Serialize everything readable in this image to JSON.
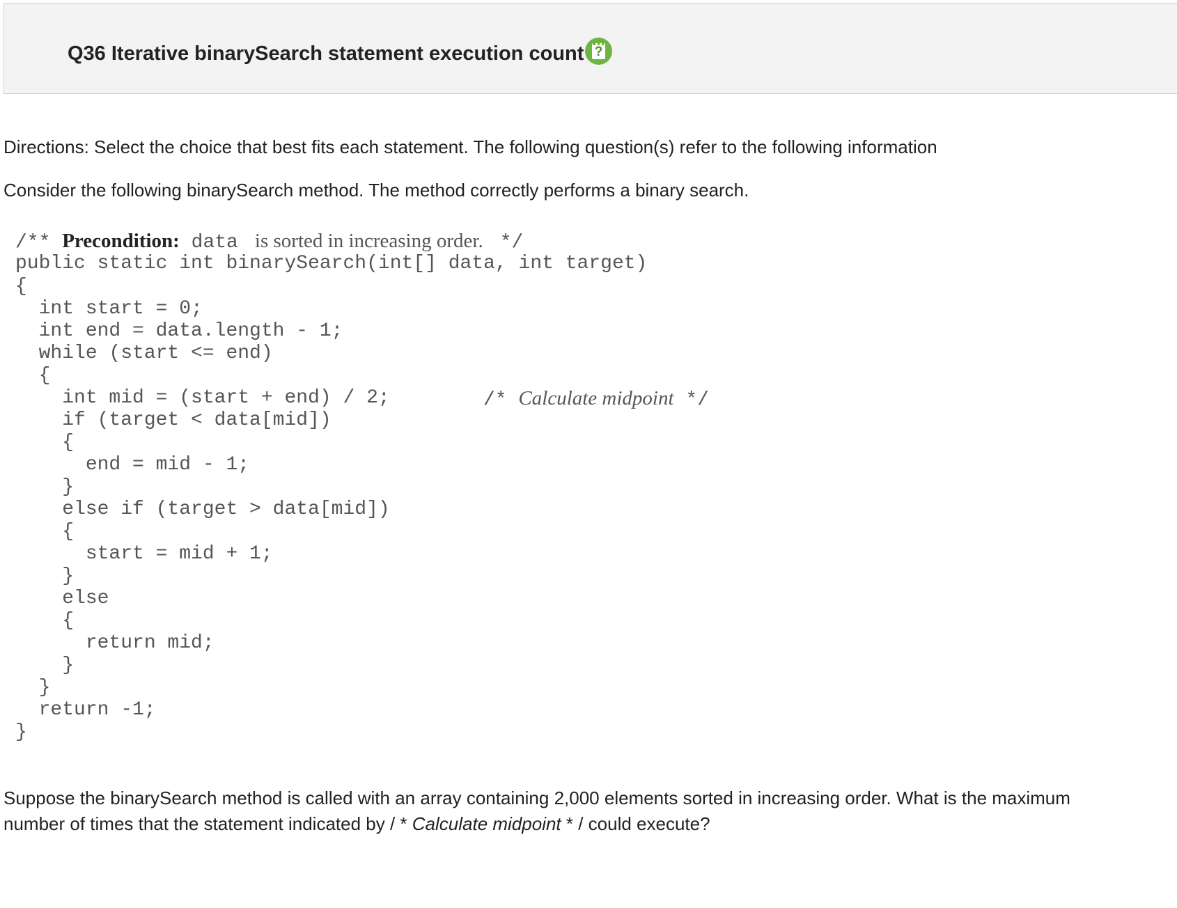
{
  "header": {
    "title": "Q36 Iterative binarySearch statement execution count",
    "help_icon": "help-question-icon"
  },
  "directions": "Directions: Select the choice that best fits each statement. The following question(s) refer to the following information",
  "intro": "Consider the following binarySearch method. The method correctly performs a binary search.",
  "code": {
    "comment_open": "/** ",
    "precondition_label": "Precondition:",
    "precondition_var": " data ",
    "precondition_text": " is sorted in increasing order. ",
    "comment_close": " */",
    "lines": [
      "public static int binarySearch(int[] data, int target)",
      "{",
      "  int start = 0;",
      "  int end = data.length - 1;",
      "  while (start <= end)",
      "  {",
      "    int mid = (start + end) / 2;",
      "    if (target < data[mid])",
      "    {",
      "      end = mid - 1;",
      "    }",
      "    else if (target > data[mid])",
      "    {",
      "      start = mid + 1;",
      "    }",
      "    else",
      "    {",
      "      return mid;",
      "    }",
      "  }",
      "  return -1;",
      "}"
    ],
    "mid_comment_open": "/* ",
    "mid_comment_text": "Calculate midpoint",
    "mid_comment_close": " */"
  },
  "question": {
    "part1": "Suppose the binarySearch method is called with an array containing 2,000 elements sorted in increasing order. What is the maximum number of times that the statement indicated by / * ",
    "emphasis": "Calculate midpoint",
    "part2": " * / could execute?"
  }
}
